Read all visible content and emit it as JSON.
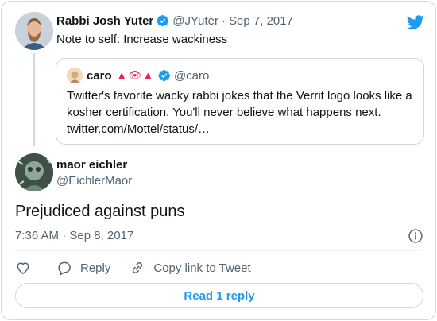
{
  "parent": {
    "name": "Rabbi Josh Yuter",
    "handle": "@JYuter",
    "separator": "·",
    "date": "Sep 7, 2017",
    "text": "Note to self: Increase wackiness"
  },
  "quote": {
    "name": "caro",
    "emoji": "▲👁▲",
    "handle": "@caro",
    "lines": [
      "Twitter's favorite wacky rabbi jokes that the Verrit logo looks like a",
      "kosher certification. You'll never believe what happens next.",
      "twitter.com/Mottel/status/…"
    ]
  },
  "reply": {
    "name": "maor eichler",
    "handle": "@EichlerMaor",
    "text": "Prejudiced against puns",
    "timestamp": "7:36 AM · Sep 8, 2017"
  },
  "actions": {
    "reply_label": "Reply",
    "copy_label": "Copy link to Tweet",
    "read_replies": "Read 1 reply"
  },
  "icons": {
    "verified": "verified-badge-icon",
    "logo": "twitter-bird-icon",
    "info": "info-icon",
    "like": "heart-icon",
    "reply": "comment-icon",
    "copy": "link-icon"
  },
  "colors": {
    "accent": "#1d9bf0",
    "text": "#0f1419",
    "secondary": "#536471",
    "border": "#cfd9de"
  }
}
